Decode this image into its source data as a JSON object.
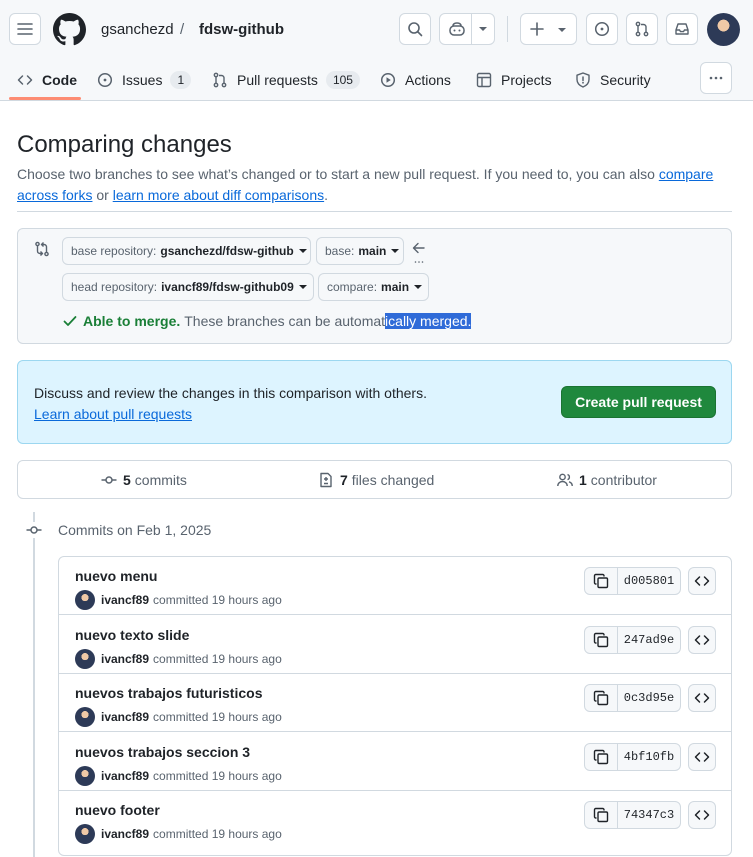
{
  "header": {
    "owner": "gsanchezd",
    "separator": "/",
    "repo": "fdsw-github"
  },
  "tabs": [
    {
      "label": "Code",
      "icon": "code-icon"
    },
    {
      "label": "Issues",
      "icon": "issue-icon",
      "count": "1"
    },
    {
      "label": "Pull requests",
      "icon": "pull-request-icon",
      "count": "105"
    },
    {
      "label": "Actions",
      "icon": "play-icon"
    },
    {
      "label": "Projects",
      "icon": "table-icon"
    },
    {
      "label": "Security",
      "icon": "shield-icon"
    }
  ],
  "page": {
    "title": "Comparing changes",
    "desc_text": "Choose two branches to see what’s changed or to start a new pull request. If you need to, you can also",
    "link1": "compare across forks",
    "or": "or",
    "link2": "learn more about diff comparisons",
    "period": "."
  },
  "compare": {
    "base_repo_label": "base repository:",
    "base_repo_value": "gsanchezd/fdsw-github",
    "base_label": "base:",
    "base_value": "main",
    "head_repo_label": "head repository:",
    "head_repo_value": "ivancf89/fdsw-github09",
    "compare_label": "compare:",
    "compare_value": "main",
    "merge_status": "Able to merge.",
    "merge_text_a": "These branches can be automat",
    "merge_text_b": "ically merged."
  },
  "pr": {
    "discuss": "Discuss and review the changes in this comparison with others.",
    "learn": "Learn about pull requests",
    "create": "Create pull request"
  },
  "stats": {
    "commits_num": "5",
    "commits_label": "commits",
    "files_num": "7",
    "files_label": "files changed",
    "contrib_num": "1",
    "contrib_label": "contributor"
  },
  "commits_date": "Commits on Feb 1, 2025",
  "commits": [
    {
      "message": "nuevo menu",
      "author": "ivancf89",
      "action": "committed 19 hours ago",
      "sha": "d005801"
    },
    {
      "message": "nuevo texto slide",
      "author": "ivancf89",
      "action": "committed 19 hours ago",
      "sha": "247ad9e"
    },
    {
      "message": "nuevos trabajos futuristicos",
      "author": "ivancf89",
      "action": "committed 19 hours ago",
      "sha": "0c3d95e"
    },
    {
      "message": "nuevos trabajos seccion 3",
      "author": "ivancf89",
      "action": "committed 19 hours ago",
      "sha": "4bf10fb"
    },
    {
      "message": "nuevo footer",
      "author": "ivancf89",
      "action": "committed 19 hours ago",
      "sha": "74347c3"
    }
  ],
  "colors": {
    "accent_green": "#1f883d",
    "link_blue": "#0969da",
    "tab_underline": "#fd8c73",
    "selection": "#2f6bd8"
  }
}
